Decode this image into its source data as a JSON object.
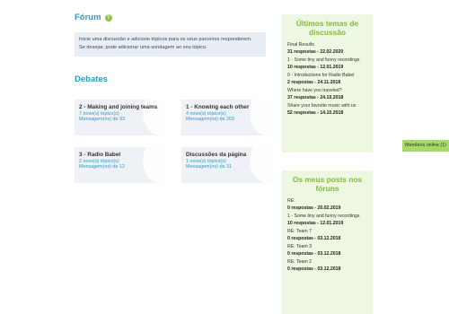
{
  "forum": {
    "title": "Fórum",
    "help_icon": "?",
    "intro_line1": "Inicie uma discussão e adicione tópicos para os seus parceiros responderem.",
    "intro_line2": "Se desejar, pode adicionar uma sondagem ao seu tópico."
  },
  "debates": {
    "title": "Debates",
    "cards": [
      {
        "title": "2 - Making and joining teams",
        "topics": "7 novo(s) tópico(s)",
        "messages": "Mensagem(ns) de 93"
      },
      {
        "title": "1 - Knowing each other",
        "topics": "4 novo(s) tópico(s)",
        "messages": "Mensagem(ns) de 203"
      },
      {
        "title": "3 - Radio Babel",
        "topics": "2 novo(s) tópico(s)",
        "messages": "Mensagem(ns) de 12"
      },
      {
        "title": "Discussões da página",
        "topics": "1 novo(s) tópico(s)",
        "messages": "Mensagem(ns) de 31"
      }
    ]
  },
  "latest_topics": {
    "title": "Últimos temas de discussão",
    "items": [
      {
        "title": "Final Results",
        "meta": "31 respostas - 22.02.2020"
      },
      {
        "title": "1 - Some tiny and funny recordings",
        "meta": "10 respostas - 12.01.2019"
      },
      {
        "title": "0 - Introductions for Radio Babel",
        "meta": "2 respostas - 24.11.2018"
      },
      {
        "title": "Where have you traveled?",
        "meta": "37 respostas - 24.10.2018"
      },
      {
        "title": "Share your favorite music with us",
        "meta": "52 respostas - 14.10.2018"
      }
    ]
  },
  "my_posts": {
    "title": "Os meus posts nos fóruns",
    "items": [
      {
        "title": "RE:",
        "meta": "0 respostas - 20.02.2019"
      },
      {
        "title": "1 - Some tiny and funny recordings",
        "meta": "10 respostas - 12.01.2019"
      },
      {
        "title": "RE: Team 7",
        "meta": "0 respostas - 03.12.2018"
      },
      {
        "title": "RE: Team 3",
        "meta": "0 respostas - 03.12.2018"
      },
      {
        "title": "RE: Team 2",
        "meta": "0 respostas - 03.12.2018"
      }
    ]
  },
  "members_online": {
    "label": "Membros online (1)"
  },
  "colors": {
    "accent_blue": "#2b9ac2",
    "accent_green": "#8dc63f",
    "side_bg": "#eef7e1"
  }
}
